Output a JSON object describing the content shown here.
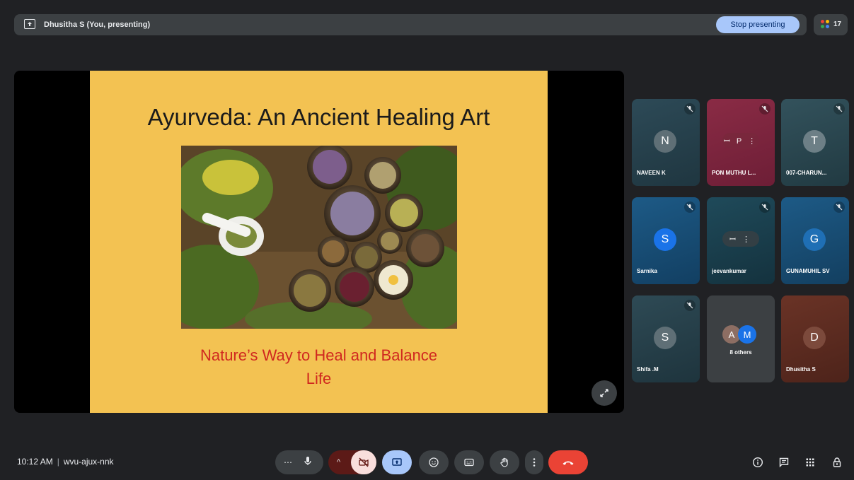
{
  "topbar": {
    "presenter_label": "Dhusitha S (You, presenting)",
    "stop_button": "Stop presenting",
    "participant_count": "17"
  },
  "slide": {
    "title": "Ayurveda: An Ancient Healing Art",
    "subtitle_line1": "Nature’s Way to Heal and Balance",
    "subtitle_line2": "Life",
    "background_color": "#f3c252",
    "subtitle_color": "#d0281f"
  },
  "participants": [
    {
      "initial": "N",
      "name": "NAVEEN K",
      "muted": true
    },
    {
      "pin_text": "ꟷ P ⋮",
      "name": "PON MUTHU L...",
      "muted": true
    },
    {
      "initial": "T",
      "name": "007-CHARUN...",
      "muted": true
    },
    {
      "initial": "S",
      "name": "Sarnika",
      "muted": true
    },
    {
      "pin_text": "ꟷ ⋮",
      "name": "jeevankumar",
      "muted": true
    },
    {
      "initial": "G",
      "name": "GUNAMUHIL SV",
      "muted": true
    },
    {
      "initial": "S",
      "name": "Shifa .M",
      "muted": true
    },
    {
      "mini_initials": [
        "A",
        "M"
      ],
      "others_label": "8 others"
    },
    {
      "initial": "D",
      "name": "Dhusitha S"
    }
  ],
  "footer": {
    "time": "10:12 AM",
    "meeting_code": "wvu-ajux-nnk"
  },
  "icons": {
    "present": "present-to-all-icon",
    "fullscreen": "expand-icon",
    "mic_off": "mic-off-icon",
    "more": "more-options-icon",
    "camera_off": "videocam-off-icon",
    "present_now": "present-screen-icon",
    "emoji": "emoji-icon",
    "captions": "captions-icon",
    "raise_hand": "raise-hand-icon",
    "end_call": "call-end-icon",
    "info": "info-icon",
    "chat": "chat-icon",
    "activities": "apps-grid-icon",
    "host_controls": "lock-person-icon"
  },
  "colors": {
    "background": "#202124",
    "accent": "#a8c7fa",
    "end_call": "#ea4335"
  }
}
